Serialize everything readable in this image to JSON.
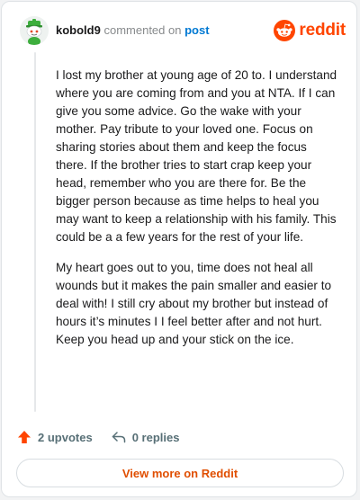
{
  "header": {
    "username": "kobold9",
    "verb": "commented on",
    "post_link": "post",
    "brand_name": "reddit",
    "brand_color": "#ff4500",
    "avatar_icon": "snoo-avatar-icon",
    "brand_icon": "reddit-logo-icon"
  },
  "comment": {
    "paragraphs": [
      "I lost my brother at young age of 20 to. I understand where you are coming from and you at NTA. If I can give you some advice. Go the wake with your mother. Pay tribute to your loved one. Focus on sharing stories about them and keep the focus there. If the brother tries to start crap keep your head, remember who you are there for. Be the bigger person because as time helps to heal you may want to keep a relationship with his family. This could be a a few years for the rest of your life.",
      "My heart goes out to you, time does not heal all wounds but it makes the pain smaller and easier to deal with! I still cry about my brother but instead of hours it’s minutes I I feel better after and not hurt. Keep you head up and your stick on the ice."
    ]
  },
  "actions": {
    "upvotes": "2 upvotes",
    "replies": "0 replies",
    "upvote_icon": "upvote-arrow-icon",
    "reply_icon": "reply-arrow-icon",
    "upvote_color": "#ff4500"
  },
  "footer": {
    "view_more": "View more on Reddit"
  }
}
